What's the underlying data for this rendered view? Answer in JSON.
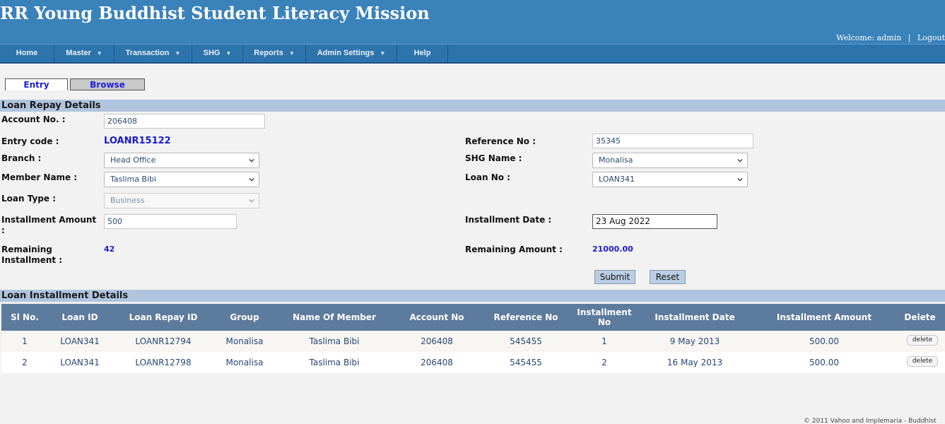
{
  "header": {
    "title": "RR Young Buddhist Student Literacy Mission",
    "welcome": "Welcome: admin",
    "separator": "|",
    "logout": "Logout"
  },
  "nav": {
    "items": [
      {
        "label": "Home",
        "has_caret": false
      },
      {
        "label": "Master",
        "has_caret": true
      },
      {
        "label": "Transaction",
        "has_caret": true
      },
      {
        "label": "SHG",
        "has_caret": true
      },
      {
        "label": "Reports",
        "has_caret": true
      },
      {
        "label": "Admin Settings",
        "has_caret": true
      },
      {
        "label": "Help",
        "has_caret": false
      }
    ]
  },
  "tabs": {
    "entry": "Entry",
    "browse": "Browse"
  },
  "form": {
    "section_title": "Loan Repay Details",
    "account_no": {
      "label": "Account No. :",
      "value": "206408"
    },
    "entry_code": {
      "label": "Entry code :",
      "value": "LOANR15122"
    },
    "reference_no": {
      "label": "Reference No :",
      "value": "35345"
    },
    "branch": {
      "label": "Branch :",
      "value": "Head Office"
    },
    "shg_name": {
      "label": "SHG Name :",
      "value": "Monalisa"
    },
    "member_name": {
      "label": "Member Name :",
      "value": "Taslima Bibi"
    },
    "loan_no": {
      "label": "Loan No :",
      "value": "LOAN341"
    },
    "loan_type": {
      "label": "Loan Type :",
      "value": "Business"
    },
    "installment_amount": {
      "label_line1": "Installment Amount",
      "label_line2": ":",
      "value": "500"
    },
    "installment_date": {
      "label": "Installment Date :",
      "value": "23 Aug 2022"
    },
    "remaining_installment": {
      "label_line1": "Remaining",
      "label_line2": "Installment :",
      "value": "42"
    },
    "remaining_amount": {
      "label": "Remaining Amount :",
      "value": "21000.00"
    },
    "submit": "Submit",
    "reset": "Reset"
  },
  "installments": {
    "section_title": "Loan Installment Details",
    "columns": {
      "sl_no": "Sl No.",
      "loan_id": "Loan ID",
      "loan_repay_id": "Loan Repay ID",
      "group": "Group",
      "member": "Name Of Member",
      "account_no": "Account No",
      "reference_no": "Reference No",
      "installment_no_1": "Installment",
      "installment_no_2": "No",
      "installment_date": "Installment Date",
      "installment_amount": "Installment Amount",
      "delete": "Delete"
    },
    "rows": [
      {
        "sl": "1",
        "loan_id": "LOAN341",
        "repay_id": "LOANR12794",
        "group": "Monalisa",
        "member": "Taslima Bibi",
        "account": "206408",
        "reference": "545455",
        "inst_no": "1",
        "date": "9 May 2013",
        "amount": "500.00",
        "delete": "delete"
      },
      {
        "sl": "2",
        "loan_id": "LOAN341",
        "repay_id": "LOANR12798",
        "group": "Monalisa",
        "member": "Taslima Bibi",
        "account": "206408",
        "reference": "545455",
        "inst_no": "2",
        "date": "16 May 2013",
        "amount": "500.00",
        "delete": "delete"
      }
    ]
  },
  "footer": {
    "text": "© 2011 Vahoo and Implemaria - Buddhist"
  },
  "colors": {
    "header_bg": "#3a82ba",
    "nav_bg": "#2e74ac",
    "section_bar": "#b0c4de",
    "grid_head": "#5d7b9d",
    "row_alt": "#f7f6f3",
    "link_blue": "#1a1acc"
  }
}
